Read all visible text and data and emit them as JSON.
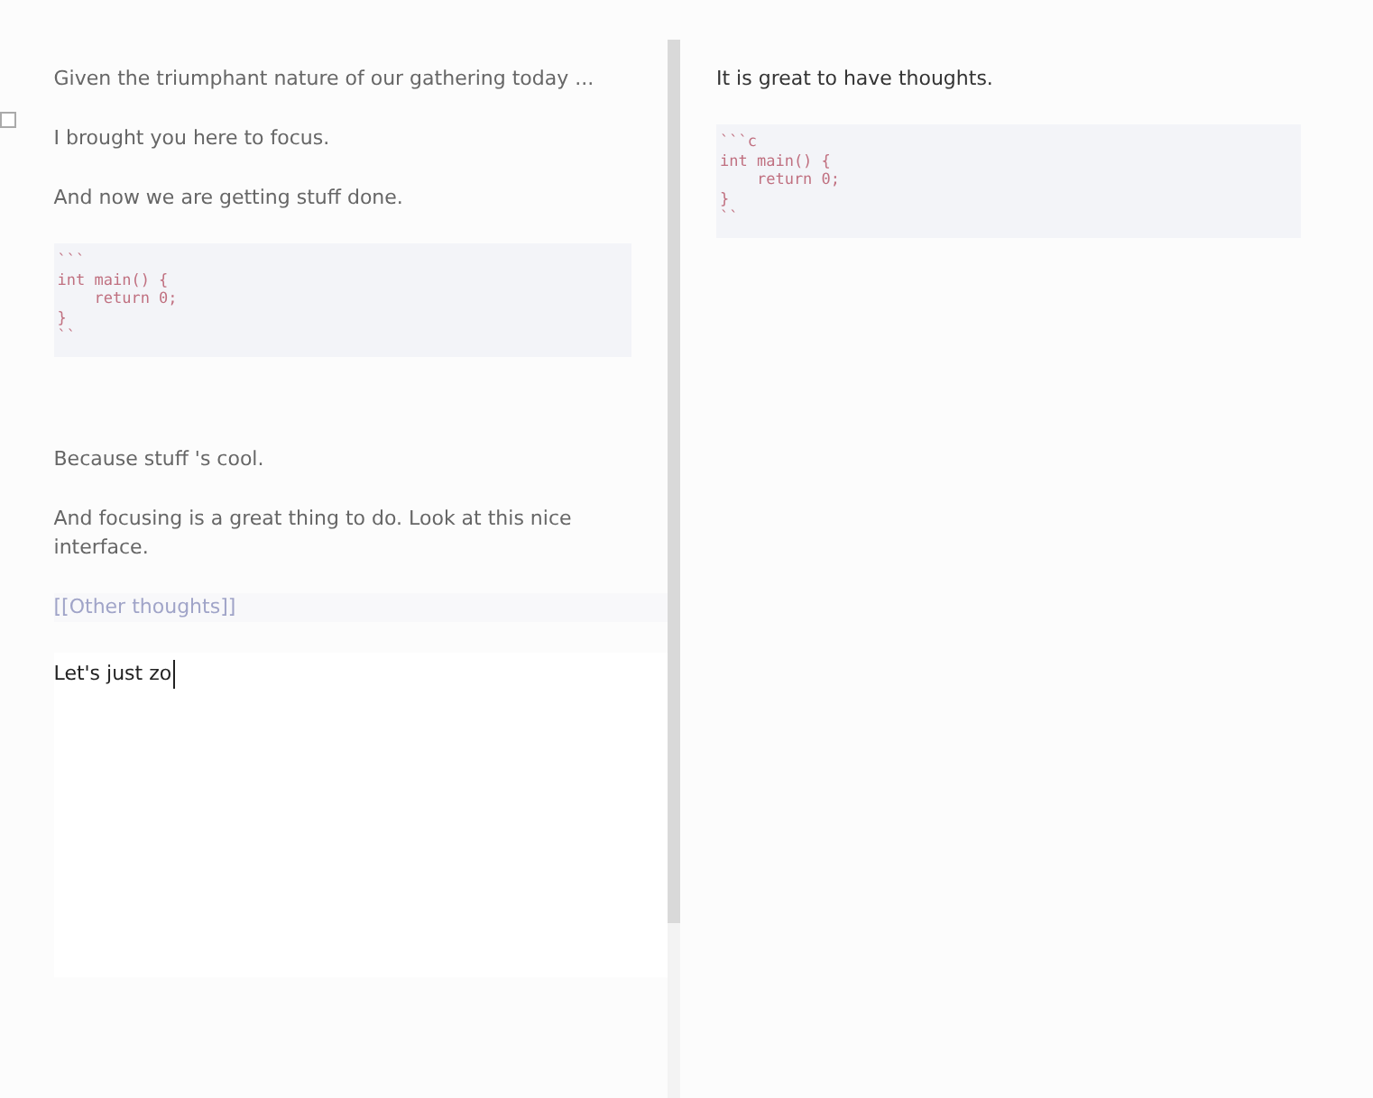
{
  "left_pane": {
    "blocks": [
      {
        "kind": "paragraph",
        "text": "Given the triumphant nature of our gathering today ..."
      },
      {
        "kind": "paragraph",
        "text": "I brought you here to focus."
      },
      {
        "kind": "paragraph",
        "text": "And now we are getting stuff done."
      },
      {
        "kind": "code",
        "lines": [
          "```",
          "int main() {",
          "    return 0;",
          "}",
          "``"
        ]
      },
      {
        "kind": "spacer"
      },
      {
        "kind": "paragraph",
        "text": "Because stuff 's cool."
      },
      {
        "kind": "paragraph",
        "text": "And focusing is a great thing to do. Look at this nice interface."
      },
      {
        "kind": "link",
        "text": "[[Other thoughts]]"
      },
      {
        "kind": "editing",
        "text": "Let's just zo"
      }
    ]
  },
  "right_pane": {
    "blocks": [
      {
        "kind": "paragraph",
        "text": "It is great to have thoughts."
      },
      {
        "kind": "code",
        "lines": [
          "```c",
          "int main() {",
          "    return 0;",
          "}",
          "``"
        ]
      }
    ]
  }
}
